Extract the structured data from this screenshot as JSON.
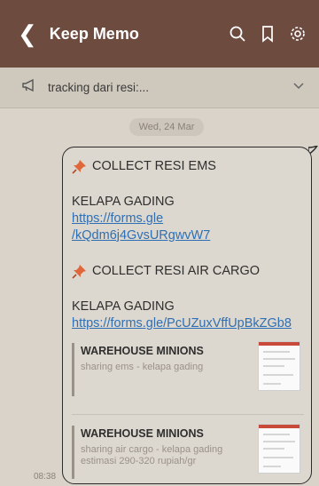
{
  "app_bar": {
    "title": "Keep Memo",
    "icons": [
      "back-icon",
      "search-icon",
      "bookmark-icon",
      "settings-icon"
    ]
  },
  "pinned": {
    "text": "tracking dari resi:..."
  },
  "date": "Wed, 24 Mar",
  "message": {
    "time": "08:38",
    "section1_title": "COLLECT RESI EMS",
    "section1_location": "KELAPA GADING",
    "section1_link_line1": "https://forms.gle",
    "section1_link_line2": "/kQdm6j4GvsURgwvW7",
    "section2_title": "COLLECT RESI AIR CARGO",
    "section2_location": "KELAPA GADING",
    "section2_link": "https://forms.gle/PcUZuxVffUpBkZGb8",
    "previews": [
      {
        "title": "WAREHOUSE MINIONS",
        "desc1": "sharing ems - kelapa gading",
        "desc2": ""
      },
      {
        "title": "WAREHOUSE MINIONS",
        "desc1": "sharing air cargo - kelapa gading",
        "desc2": "estimasi 290-320 rupiah/gr"
      }
    ]
  },
  "colors": {
    "app_bar": "#6e4b3f",
    "link": "#2f6fb4",
    "background": "#d9d3c9"
  }
}
